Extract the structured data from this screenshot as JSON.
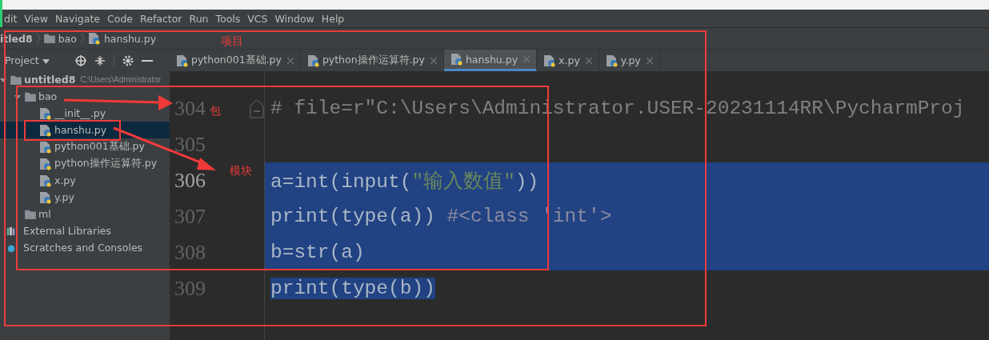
{
  "menu": [
    "dit",
    "View",
    "Navigate",
    "Code",
    "Refactor",
    "Run",
    "Tools",
    "VCS",
    "Window",
    "Help"
  ],
  "breadcrumb": [
    {
      "label": "itled8",
      "kind": "project"
    },
    {
      "label": "bao",
      "kind": "folder"
    },
    {
      "label": "hanshu.py",
      "kind": "file"
    }
  ],
  "project_panel": {
    "title": "Project"
  },
  "tree": [
    {
      "label": "untitled8",
      "path": "C:\\Users\\Administrator",
      "kind": "root",
      "expanded": true,
      "selected": false,
      "children": [
        {
          "label": "bao",
          "kind": "folder",
          "expanded": true,
          "selected": false,
          "children": [
            {
              "label": "__init__.py",
              "kind": "file",
              "selected": false
            },
            {
              "label": "hanshu.py",
              "kind": "file",
              "selected": true
            },
            {
              "label": "python001基础.py",
              "kind": "file",
              "selected": false
            },
            {
              "label": "python操作运算符.py",
              "kind": "file",
              "selected": false
            },
            {
              "label": "x.py",
              "kind": "file",
              "selected": false
            },
            {
              "label": "y.py",
              "kind": "file",
              "selected": false
            }
          ]
        },
        {
          "label": "ml",
          "kind": "folder",
          "expanded": false,
          "selected": false
        }
      ]
    },
    {
      "label": "External Libraries",
      "kind": "libraries",
      "selected": false
    },
    {
      "label": "Scratches and Consoles",
      "kind": "scratches",
      "selected": false
    }
  ],
  "tabs": [
    {
      "label": "python001基础.py",
      "selected": false
    },
    {
      "label": "python操作运算符.py",
      "selected": false
    },
    {
      "label": "hanshu.py",
      "selected": true
    },
    {
      "label": "x.py",
      "selected": false
    },
    {
      "label": "y.py",
      "selected": false
    }
  ],
  "code_lines": [
    {
      "number": "304",
      "selected": false,
      "tokens": [
        {
          "text": "# file=r\"C:\\Users\\Administrator.USER-20231114RR\\PycharmProj",
          "kind": "comment"
        }
      ]
    },
    {
      "number": "305",
      "selected": false
    },
    {
      "number": "306",
      "selected": true,
      "tokens": [
        {
          "text": "a",
          "kind": "plain"
        },
        {
          "text": "=",
          "kind": "plain"
        },
        {
          "text": "int(input(",
          "kind": "plain"
        },
        {
          "text": "\"输入数值\"",
          "kind": "string"
        },
        {
          "text": "))",
          "kind": "plain"
        }
      ]
    },
    {
      "number": "307",
      "selected": true,
      "tokens": [
        {
          "text": "print(type(a)) ",
          "kind": "plain"
        },
        {
          "text": "#<class 'int'>",
          "kind": "comment"
        }
      ]
    },
    {
      "number": "308",
      "selected": true,
      "tokens": [
        {
          "text": "b",
          "kind": "plain"
        },
        {
          "text": "=",
          "kind": "plain"
        },
        {
          "text": "str(a)",
          "kind": "plain"
        }
      ]
    },
    {
      "number": "309",
      "selected": false,
      "tokens": [
        {
          "text": "print(type(b))",
          "kind": "selected_plain"
        }
      ]
    }
  ],
  "annotations": [
    {
      "text": "项目",
      "kind": "project"
    },
    {
      "text": "包",
      "kind": "package"
    },
    {
      "text": "模块",
      "kind": "module"
    }
  ]
}
